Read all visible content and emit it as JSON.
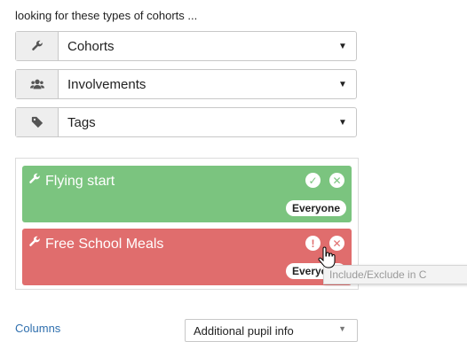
{
  "heading": "looking for these types of cohorts ...",
  "selects": [
    {
      "label": "Cohorts",
      "icon": "wrench-icon"
    },
    {
      "label": "Involvements",
      "icon": "users-icon"
    },
    {
      "label": "Tags",
      "icon": "tag-icon"
    }
  ],
  "cohorts": [
    {
      "name": "Flying start",
      "badge": "Everyone",
      "status": "included",
      "color": "#7bc47f",
      "actions": [
        "check-icon",
        "close-icon"
      ]
    },
    {
      "name": "Free School Meals",
      "badge": "Everyone",
      "status": "excluded",
      "color": "#e06d6d",
      "actions": [
        "exclamation-icon",
        "close-icon"
      ]
    }
  ],
  "tooltip": "Include/Exclude in C",
  "columns": {
    "label": "Columns",
    "selected": "Additional pupil info"
  }
}
